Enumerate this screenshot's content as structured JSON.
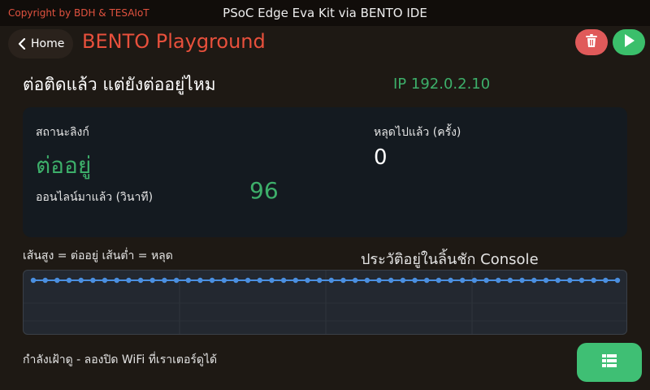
{
  "header": {
    "copyright": "Copyright by BDH & TESAIoT",
    "app_title": "PSoC Edge Eva Kit via BENTO IDE"
  },
  "nav": {
    "home_label": "Home",
    "page_title": "BENTO Playground",
    "delete_icon": "trash-icon",
    "run_icon": "play-icon"
  },
  "status": {
    "heading": "ต่อติดแล้ว แต่ยังต่ออยู่ไหม",
    "ip": "IP 192.0.2.10"
  },
  "card": {
    "link_status_label": "สถานะลิงก์",
    "link_status_value": "ต่ออยู่",
    "online_label": "ออนไลน์มาแล้ว (วินาที)",
    "online_value": "96",
    "dropped_label": "หลุดไปแล้ว (ครั้ง)",
    "dropped_value": "0"
  },
  "chart_section": {
    "legend": "เส้นสูง = ต่ออยู่  เส้นต่ำ = หลุด",
    "history_title": "ประวัติอยู่ในลิ้นชัก Console"
  },
  "chart_data": {
    "type": "line",
    "color": "#4a8fe0",
    "ylim": [
      0,
      1
    ],
    "values": [
      1,
      1,
      1,
      1,
      1,
      1,
      1,
      1,
      1,
      1,
      1,
      1,
      1,
      1,
      1,
      1,
      1,
      1,
      1,
      1,
      1,
      1,
      1,
      1,
      1,
      1,
      1,
      1,
      1,
      1,
      1,
      1,
      1,
      1,
      1,
      1,
      1,
      1,
      1,
      1,
      1,
      1,
      1,
      1,
      1,
      1,
      1,
      1,
      1,
      1
    ]
  },
  "footer": {
    "hint": "กำลังเฝ้าดู - ลองปิด WiFi ที่เราเตอร์ดูได้",
    "console_icon": "table-icon"
  },
  "colors": {
    "accent_red": "#e8503c",
    "accent_green": "#3daf6a",
    "button_green": "#3fbf74",
    "button_red": "#e05a5a"
  }
}
